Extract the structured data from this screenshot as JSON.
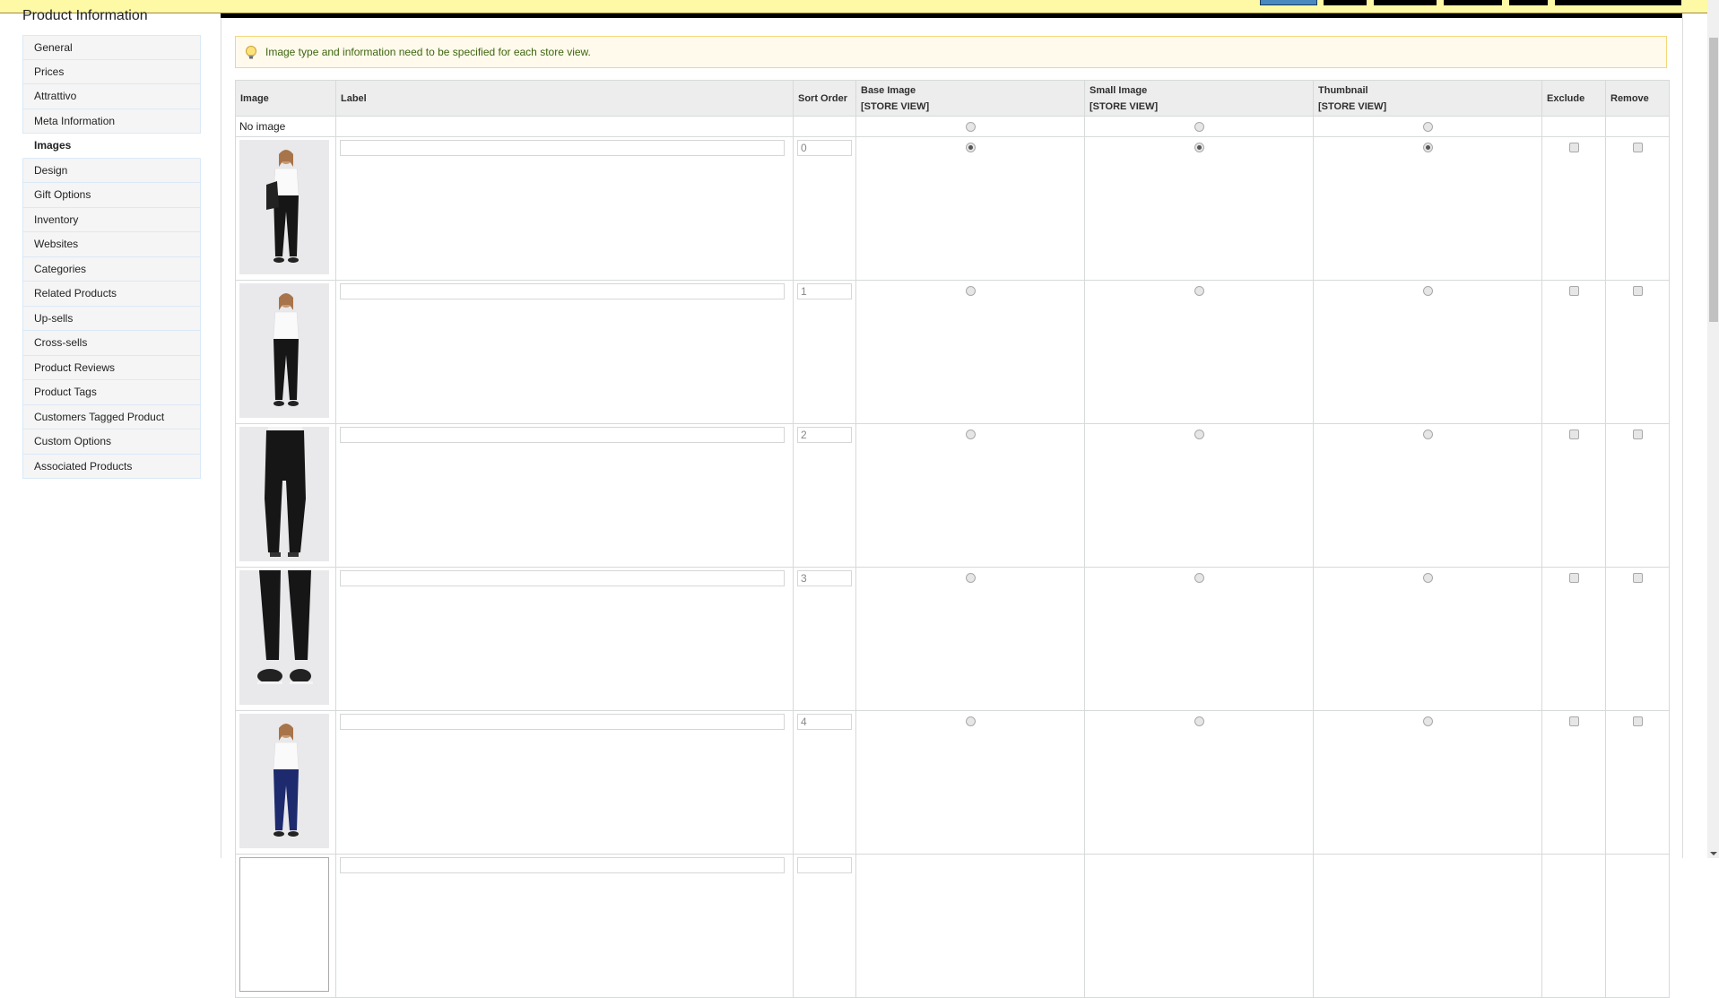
{
  "topbar": {
    "buttons": [
      {
        "name": "toolbar-button-1",
        "active": true
      },
      {
        "name": "toolbar-button-2",
        "active": false
      },
      {
        "name": "toolbar-button-3",
        "active": false
      },
      {
        "name": "toolbar-button-4",
        "active": false
      },
      {
        "name": "toolbar-button-5",
        "active": false
      },
      {
        "name": "toolbar-button-6",
        "active": false
      }
    ]
  },
  "sidebar": {
    "title": "Product Information",
    "items": [
      {
        "label": "General",
        "active": false
      },
      {
        "label": "Prices",
        "active": false
      },
      {
        "label": "Attrattivo",
        "active": false
      },
      {
        "label": "Meta Information",
        "active": false
      },
      {
        "label": "Images",
        "active": true
      },
      {
        "label": "Design",
        "active": false
      },
      {
        "label": "Gift Options",
        "active": false
      },
      {
        "label": "Inventory",
        "active": false
      },
      {
        "label": "Websites",
        "active": false
      },
      {
        "label": "Categories",
        "active": false
      },
      {
        "label": "Related Products",
        "active": false
      },
      {
        "label": "Up-sells",
        "active": false
      },
      {
        "label": "Cross-sells",
        "active": false
      },
      {
        "label": "Product Reviews",
        "active": false
      },
      {
        "label": "Product Tags",
        "active": false
      },
      {
        "label": "Customers Tagged Product",
        "active": false
      },
      {
        "label": "Custom Options",
        "active": false
      },
      {
        "label": "Associated Products",
        "active": false
      }
    ]
  },
  "notice": {
    "icon": "lightbulb-icon",
    "message": "Image type and information need to be specified for each store view."
  },
  "table": {
    "headers": {
      "image": "Image",
      "label": "Label",
      "sort_order": "Sort Order",
      "base_image": "Base Image",
      "small_image": "Small Image",
      "thumbnail": "Thumbnail",
      "scope": "[STORE VIEW]",
      "exclude": "Exclude",
      "remove": "Remove"
    },
    "no_image_row": {
      "text": "No image",
      "base_checked": false,
      "small_checked": false,
      "thumb_checked": false
    },
    "rows": [
      {
        "image": "woman-black-pants-backpack",
        "label": "",
        "sort_order": "0",
        "base": true,
        "small": true,
        "thumb": true,
        "exclude": false,
        "remove": false
      },
      {
        "image": "woman-black-pants-front",
        "label": "",
        "sort_order": "1",
        "base": false,
        "small": false,
        "thumb": false,
        "exclude": false,
        "remove": false
      },
      {
        "image": "black-pants-back",
        "label": "",
        "sort_order": "2",
        "base": false,
        "small": false,
        "thumb": false,
        "exclude": false,
        "remove": false
      },
      {
        "image": "black-pants-legs-sneakers",
        "label": "",
        "sort_order": "3",
        "base": false,
        "small": false,
        "thumb": false,
        "exclude": false,
        "remove": false
      },
      {
        "image": "woman-navy-pants-front",
        "label": "",
        "sort_order": "4",
        "base": false,
        "small": false,
        "thumb": false,
        "exclude": false,
        "remove": false
      }
    ]
  },
  "colors": {
    "topbar_bg": "#fdf9a4",
    "active_button": "#4a88c0",
    "notice_bg": "#fffaeb",
    "notice_border": "#f5d67a",
    "notice_text": "#3d6611",
    "header_bg": "#ededed",
    "navy_pants": "#1e2a6e"
  }
}
